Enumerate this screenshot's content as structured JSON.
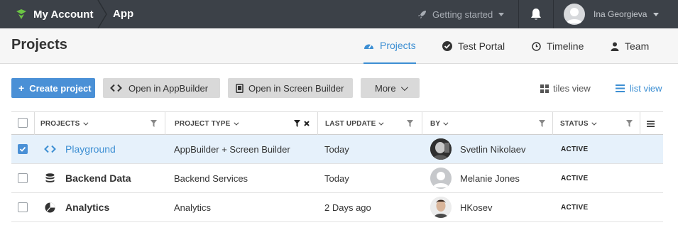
{
  "topbar": {
    "brand_title": "My Account",
    "breadcrumb_app": "App",
    "getting_started": "Getting started",
    "user_name": "Ina Georgieva",
    "colors": {
      "background": "#3c4148",
      "brand_green": "#6cc644"
    }
  },
  "header": {
    "page_title": "Projects",
    "tabs": [
      {
        "label": "Projects",
        "icon": "dashboard-icon",
        "active": true
      },
      {
        "label": "Test Portal",
        "icon": "check-circle-icon",
        "active": false
      },
      {
        "label": "Timeline",
        "icon": "clock-icon",
        "active": false
      },
      {
        "label": "Team",
        "icon": "user-icon",
        "active": false
      }
    ]
  },
  "toolbar": {
    "create_project": "Create project",
    "open_appbuilder": "Open in AppBuilder",
    "open_screenbuilder": "Open in Screen Builder",
    "more": "More",
    "tiles_view": "tiles view",
    "list_view": "list view",
    "accent": "#4a90d6"
  },
  "table": {
    "columns": [
      "PROJECTS",
      "PROJECT TYPE",
      "LAST UPDATE",
      "BY",
      "STATUS"
    ],
    "rows": [
      {
        "name": "Playground",
        "icon": "code-brackets-icon",
        "type": "AppBuilder + Screen Builder",
        "updated": "Today",
        "by": "Svetlin Nikolaev",
        "avatar": "photo",
        "status": "ACTIVE",
        "selected": true
      },
      {
        "name": "Backend Data",
        "icon": "database-icon",
        "type": "Backend Services",
        "updated": "Today",
        "by": "Melanie Jones",
        "avatar": "placeholder",
        "status": "ACTIVE",
        "selected": false
      },
      {
        "name": "Analytics",
        "icon": "analytics-icon",
        "type": "Analytics",
        "updated": "2 Days ago",
        "by": "HKosev",
        "avatar": "photo",
        "status": "ACTIVE",
        "selected": false
      }
    ]
  }
}
